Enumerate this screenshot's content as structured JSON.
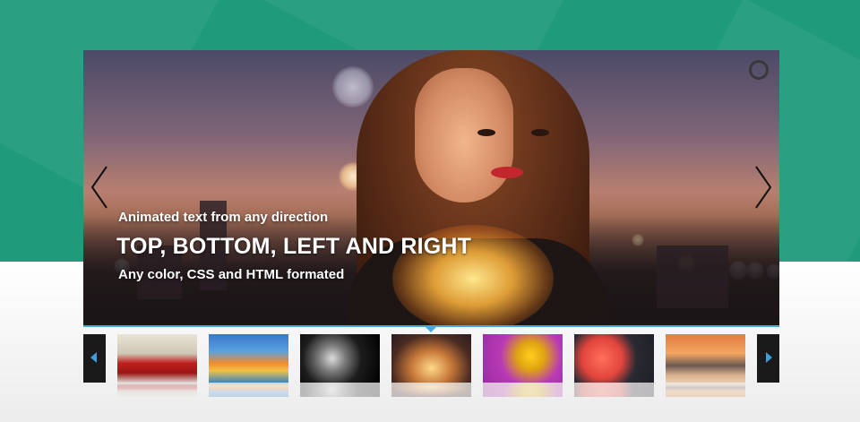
{
  "slider": {
    "captions": {
      "line1": "Animated text from any direction",
      "line2": "TOP, BOTTOM, LEFT AND RIGHT",
      "line3": "Any color, CSS and HTML formated"
    },
    "active_thumb_index": 3,
    "colors": {
      "background_top": "#1f9a7b",
      "accent": "#4aa8e0",
      "thumb_nav_bg": "#1a1a1a"
    }
  },
  "thumbnails": [
    {
      "icon": "red-car-thumbnail"
    },
    {
      "icon": "beach-sunset-thumbnail"
    },
    {
      "icon": "black-white-abstract-thumbnail"
    },
    {
      "icon": "woman-lights-thumbnail"
    },
    {
      "icon": "sunflowers-thumbnail"
    },
    {
      "icon": "grapefruit-thumbnail"
    },
    {
      "icon": "seascape-thumbnail"
    }
  ]
}
